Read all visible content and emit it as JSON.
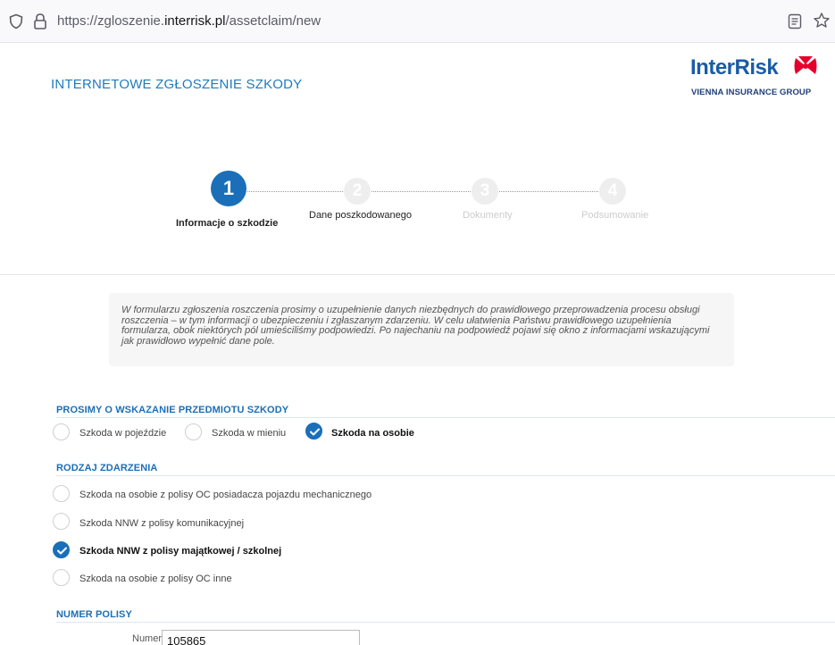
{
  "browser": {
    "url_prefix": "https://zgloszenie.",
    "url_domain": "interrisk.pl",
    "url_path": "/assetclaim/new"
  },
  "header": {
    "title": "INTERNETOWE ZGŁOSZENIE SZKODY",
    "logo_name": "InterRisk",
    "logo_sub": "VIENNA INSURANCE GROUP",
    "colors": {
      "brand_blue": "#1a5ca6",
      "accent_red": "#e4002b",
      "link_blue": "#1f7bbf"
    }
  },
  "stepper": {
    "steps": [
      {
        "number": "1",
        "label": "Informacje o szkodzie",
        "state": "active"
      },
      {
        "number": "2",
        "label": "Dane poszkodowanego",
        "state": "current"
      },
      {
        "number": "3",
        "label": "Dokumenty",
        "state": "disabled"
      },
      {
        "number": "4",
        "label": "Podsumowanie",
        "state": "disabled"
      }
    ]
  },
  "info": {
    "text": "W formularzu zgłoszenia roszczenia prosimy o uzupełnienie danych niezbędnych do prawidłowego przeprowadzenia procesu obsługi roszczenia – w tym informacji o ubezpieczeniu i zgłaszanym zdarzeniu. W celu ułatwienia Państwu prawidłowego uzupełnienia formularza, obok niektórych pól umieściliśmy podpowiedzi. Po najechaniu na  podpowiedź pojawi się okno z informacjami wskazującymi jak prawidłowo wypełnić dane pole."
  },
  "subject": {
    "title": "PROSIMY O WSKAZANIE PRZEDMIOTU SZKODY",
    "options": [
      {
        "label": "Szkoda w pojeździe",
        "checked": false
      },
      {
        "label": "Szkoda w mieniu",
        "checked": false
      },
      {
        "label": "Szkoda na osobie",
        "checked": true
      }
    ]
  },
  "event_type": {
    "title": "RODZAJ ZDARZENIA",
    "options": [
      {
        "label": "Szkoda na osobie z polisy OC posiadacza pojazdu mechanicznego",
        "checked": false
      },
      {
        "label": "Szkoda NNW z polisy komunikacyjnej",
        "checked": false
      },
      {
        "label": "Szkoda NNW z polisy majątkowej / szkolnej",
        "checked": true
      },
      {
        "label": "Szkoda na osobie z polisy OC inne",
        "checked": false
      }
    ]
  },
  "policy": {
    "title": "NUMER POLISY",
    "number_label": "Numer :",
    "number_value": "105865"
  }
}
